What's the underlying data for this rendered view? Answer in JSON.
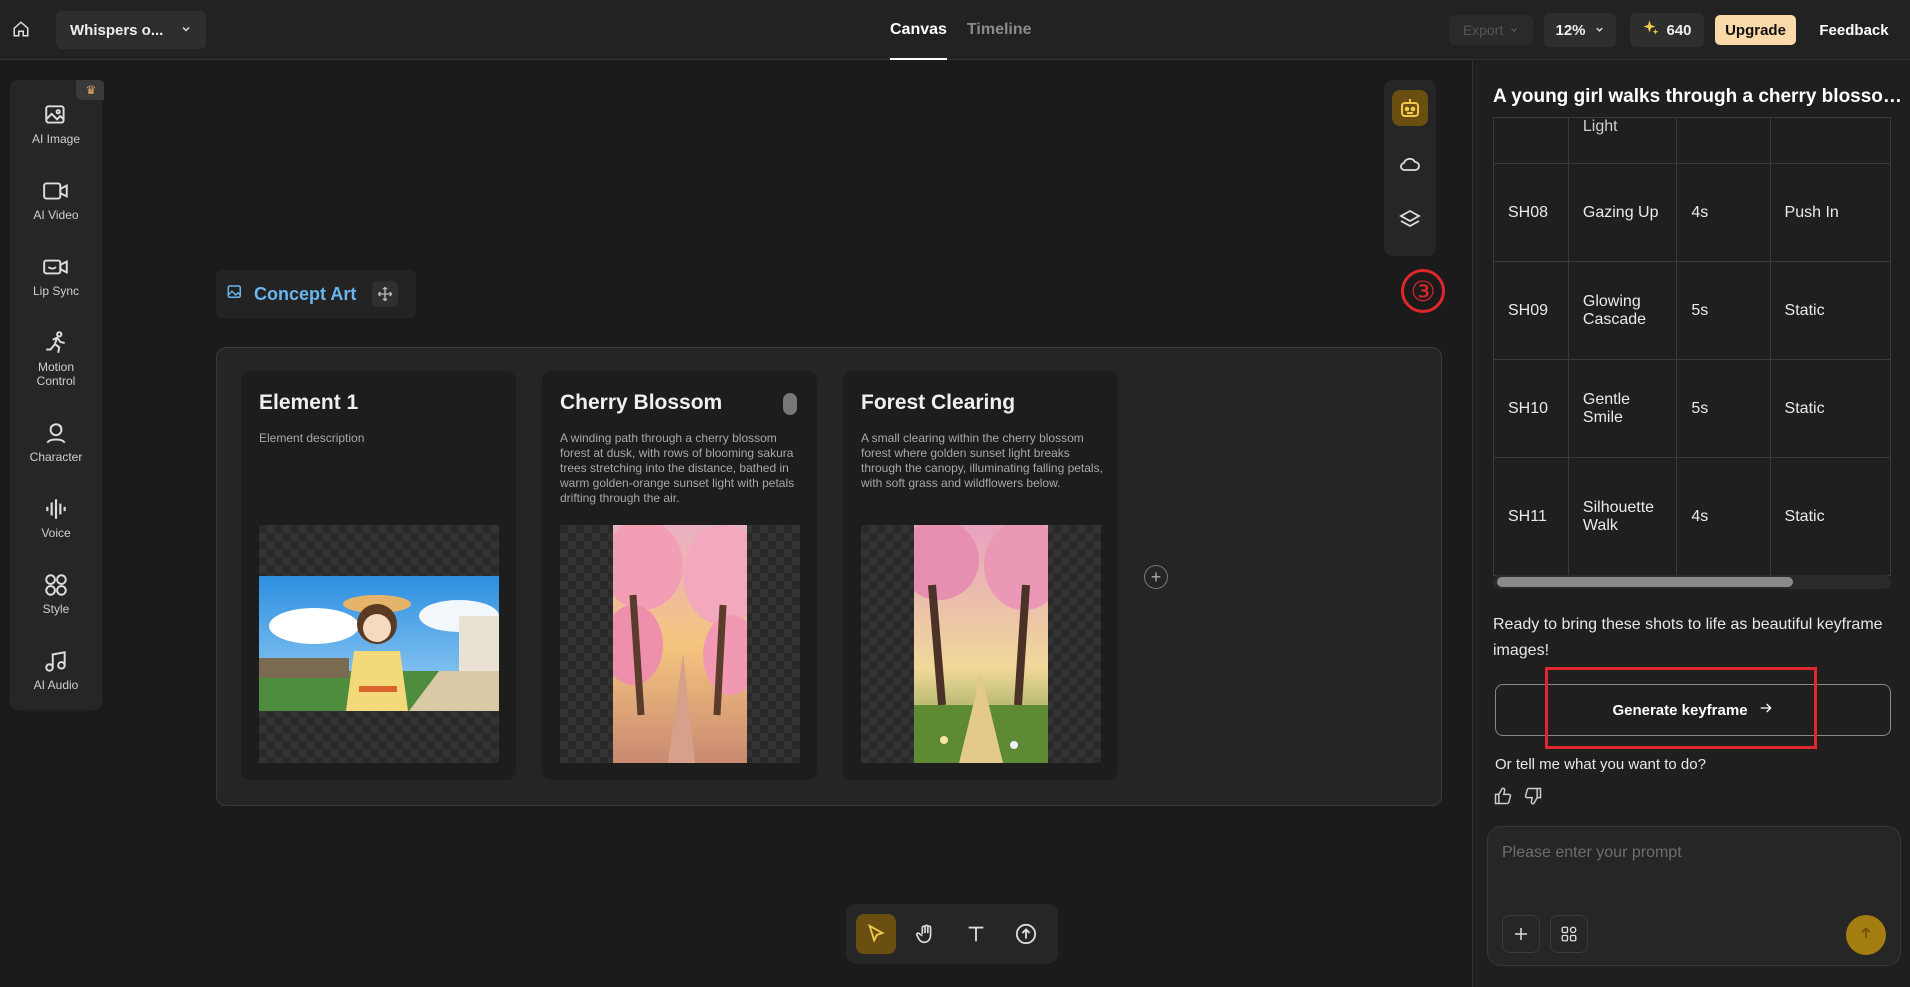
{
  "topbar": {
    "project_name": "Whispers o...",
    "tabs": [
      {
        "label": "Canvas"
      },
      {
        "label": "Timeline"
      }
    ],
    "export_label": "Export",
    "zoom": "12%",
    "credits": "640",
    "upgrade_label": "Upgrade",
    "feedback_label": "Feedback"
  },
  "left_tools": [
    {
      "label": "AI Image",
      "icon": "ai-image-icon"
    },
    {
      "label": "AI Video",
      "icon": "ai-video-icon"
    },
    {
      "label": "Lip Sync",
      "icon": "lip-sync-icon"
    },
    {
      "label": "Motion Control",
      "icon": "motion-control-icon"
    },
    {
      "label": "Character",
      "icon": "character-icon"
    },
    {
      "label": "Voice",
      "icon": "voice-icon"
    },
    {
      "label": "Style",
      "icon": "style-icon"
    },
    {
      "label": "AI Audio",
      "icon": "ai-audio-icon"
    }
  ],
  "canvas": {
    "annotation_number": "③",
    "group_label": "Concept Art",
    "cards": [
      {
        "title": "Element 1",
        "description": "Element description"
      },
      {
        "title": "Cherry Blossom",
        "description": "A winding path through a cherry blossom forest at dusk, with rows of blooming sakura trees stretching into the distance, bathed in warm golden-orange sunset light with petals drifting through the air."
      },
      {
        "title": "Forest Clearing",
        "description": "A small clearing within the cherry blossom forest where golden sunset light breaks through the canopy, illuminating falling petals, with soft grass and wildflowers below."
      }
    ]
  },
  "panel": {
    "title": "A young girl walks through a cherry blossom forest",
    "partial_row_text": "Light",
    "shots": [
      {
        "id": "SH08",
        "name": "Gazing Up",
        "duration": "4s",
        "camera": "Push In"
      },
      {
        "id": "SH09",
        "name": "Glowing Cascade",
        "duration": "5s",
        "camera": "Static"
      },
      {
        "id": "SH10",
        "name": "Gentle Smile",
        "duration": "5s",
        "camera": "Static"
      },
      {
        "id": "SH11",
        "name": "Silhouette Walk",
        "duration": "4s",
        "camera": "Static"
      }
    ],
    "ready_text": "Ready to bring these shots to life as beautiful keyframe images!",
    "generate_label": "Generate keyframe",
    "tell_me": "Or tell me what you want to do?",
    "prompt_placeholder": "Please enter your prompt"
  },
  "colors": {
    "accent": "#f2c94c",
    "annotation_red": "#e0272b",
    "group_label": "#69b5f0",
    "upgrade_bg": "#fcd9a8"
  }
}
